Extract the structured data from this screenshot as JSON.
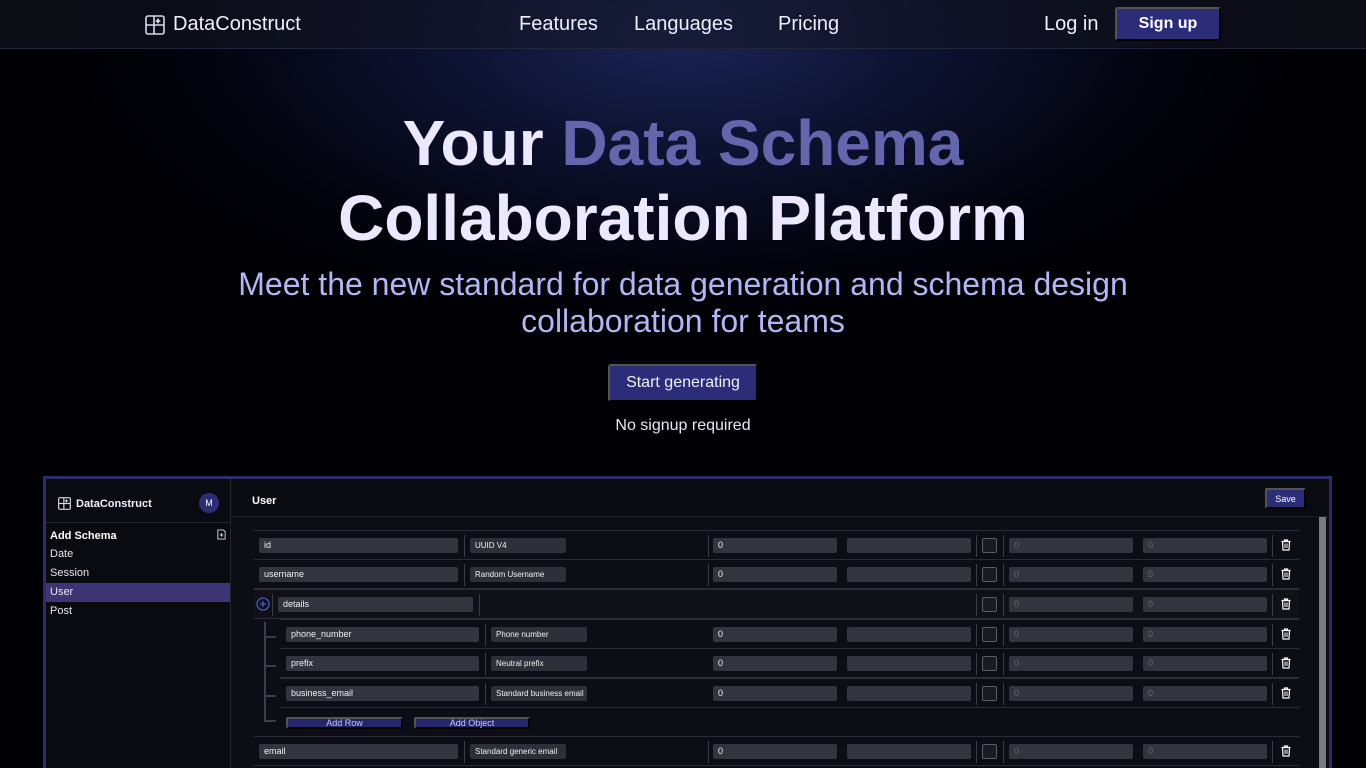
{
  "nav": {
    "brand": "DataConstruct",
    "links": [
      "Features",
      "Languages",
      "Pricing"
    ],
    "login": "Log in",
    "signup": "Sign up"
  },
  "hero": {
    "title_prefix": "Your",
    "title_accent": "Data Schema",
    "title_line2": "Collaboration Platform",
    "subtitle": "Meet the new standard for data generation and schema design collaboration for teams",
    "cta": "Start generating",
    "note": "No signup required"
  },
  "app": {
    "brand": "DataConstruct",
    "avatar": "M",
    "add_schema": "Add Schema",
    "schemas": [
      "Date",
      "Session",
      "User",
      "Post"
    ],
    "active_schema": "User",
    "title": "User",
    "save": "Save",
    "rows": [
      {
        "name": "id",
        "type": "UUID V4",
        "value": "0",
        "min": "0",
        "max": "0"
      },
      {
        "name": "username",
        "type": "Random Username",
        "value": "0",
        "min": "0",
        "max": "0"
      },
      {
        "name": "details",
        "min": "0",
        "max": "0"
      },
      {
        "name": "phone_number",
        "type": "Phone number",
        "value": "0",
        "min": "0",
        "max": "0"
      },
      {
        "name": "prefix",
        "type": "Neutral prefix",
        "value": "0",
        "min": "0",
        "max": "0"
      },
      {
        "name": "business_email",
        "type": "Standard business email",
        "value": "0",
        "min": "0",
        "max": "0"
      },
      {
        "name": "email",
        "type": "Standard generic email",
        "value": "0",
        "min": "0",
        "max": "0"
      }
    ],
    "add_row": "Add Row",
    "add_object": "Add Object"
  },
  "colors": {
    "accent": "#2b2d79",
    "title_accent": "#6466ad",
    "subtitle": "#b3b6f4",
    "active_item": "#3f3575"
  }
}
